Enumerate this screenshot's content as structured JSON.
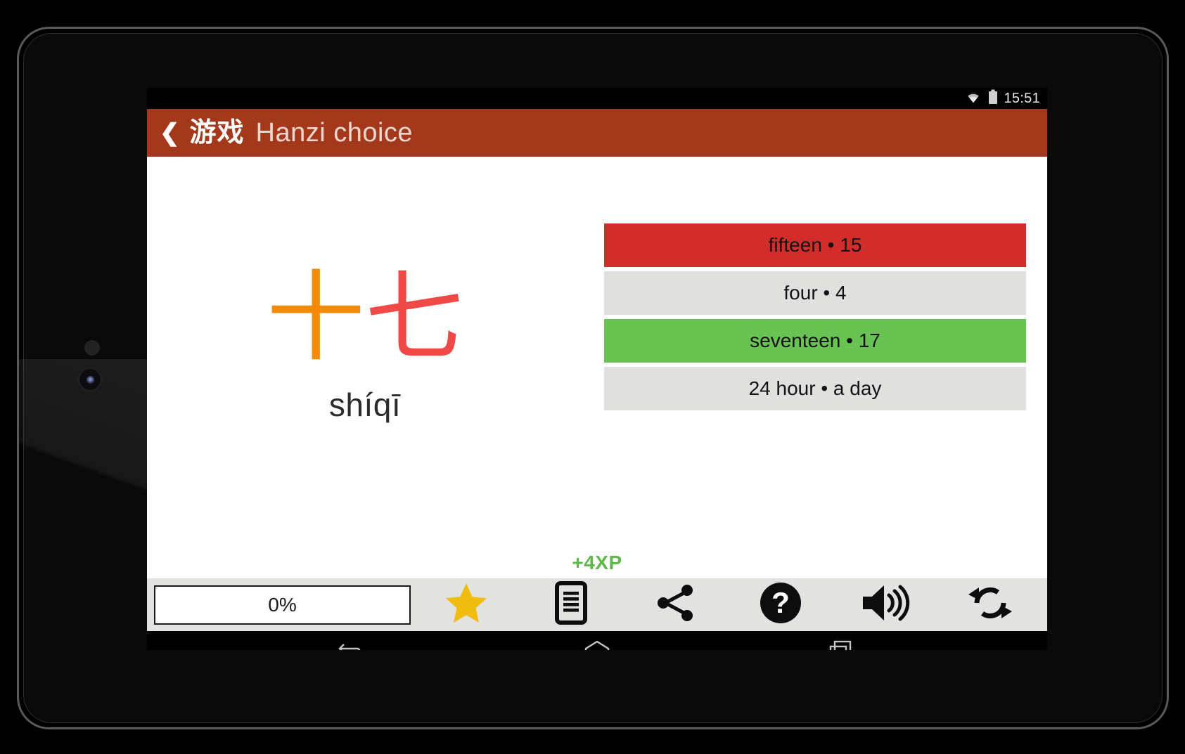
{
  "device": {
    "camera_icon": "front-camera",
    "sensor_icon": "proximity-sensor"
  },
  "statusbar": {
    "wifi_icon": "wifi-icon",
    "battery_icon": "battery-icon",
    "clock": "15:51"
  },
  "appbar": {
    "back_icon": "back-chevron-icon",
    "parent_title": "游戏",
    "title": "Hanzi choice",
    "background_color": "#a3391a"
  },
  "prompt": {
    "characters": [
      {
        "glyph": "十",
        "color": "#f58a07"
      },
      {
        "glyph": "七",
        "color": "#ef4a48"
      }
    ],
    "pinyin": "shíqī"
  },
  "answers": [
    {
      "label": "fifteen • 15",
      "state": "wrong",
      "color": "#d22d2b"
    },
    {
      "label": "four • 4",
      "state": "neutral",
      "color": "#e0e0de"
    },
    {
      "label": "seventeen • 17",
      "state": "correct",
      "color": "#69c353"
    },
    {
      "label": "24 hour • a day",
      "state": "neutral",
      "color": "#e0e0de"
    }
  ],
  "xp": {
    "label": "+4XP",
    "color": "#5fb84c"
  },
  "toolbar": {
    "progress_label": "0%",
    "buttons": [
      {
        "icon": "star-icon",
        "name": "favorite-button"
      },
      {
        "icon": "list-icon",
        "name": "list-button"
      },
      {
        "icon": "share-icon",
        "name": "share-button"
      },
      {
        "icon": "help-icon",
        "name": "help-button"
      },
      {
        "icon": "speaker-icon",
        "name": "sound-button"
      },
      {
        "icon": "refresh-icon",
        "name": "refresh-button"
      }
    ]
  },
  "navbar": {
    "back_icon": "android-back-icon",
    "home_icon": "android-home-icon",
    "recents_icon": "android-recents-icon"
  }
}
